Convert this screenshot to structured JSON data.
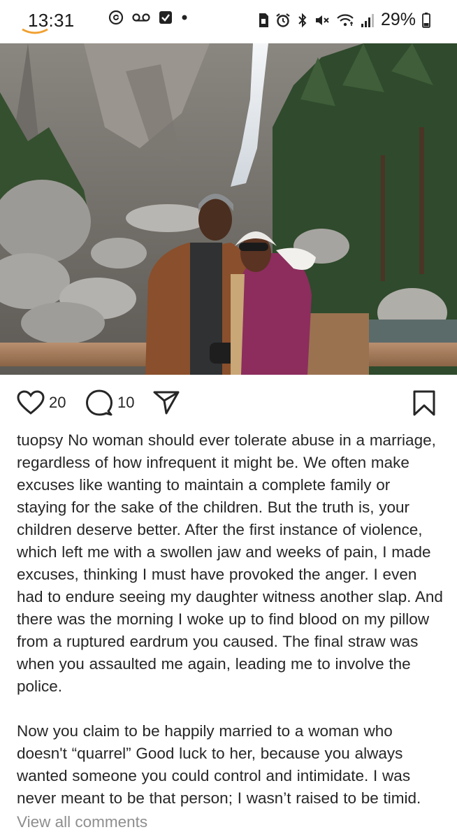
{
  "status_bar": {
    "time": "13:31",
    "battery_percent": "29%",
    "left_icons": [
      "threads-icon",
      "voicemail-icon",
      "checkbox-icon",
      "dot-icon"
    ],
    "right_icons": [
      "sim-icon",
      "alarm-icon",
      "bluetooth-icon",
      "mute-icon",
      "wifi-icon",
      "signal-icon",
      "battery-icon"
    ]
  },
  "post": {
    "image_alt": "",
    "likes_count": "20",
    "comments_count": "10",
    "username": "tuopsy",
    "caption_paragraph_1": "No woman should ever tolerate abuse in a marriage, regardless of how infrequent it might be. We often make excuses like wanting to maintain a complete family or staying for the sake of the children. But the truth is, your children deserve better. After the first instance of violence, which left me with a swollen jaw and weeks of pain, I made excuses, thinking I must have provoked the anger. I even had to endure seeing my daughter witness another slap. And there was the morning I woke up to find blood on my pillow from a ruptured eardrum you caused. The final straw was when you assaulted me again, leading me to involve the police.",
    "caption_paragraph_2": "Now you claim to be happily married to a woman who doesn't “quarrel” Good luck to her, because you always wanted someone you could control and intimidate. I was never meant to be that person; I wasn’t raised to be timid.",
    "view_all_comments": "View all comments"
  },
  "colors": {
    "text": "#262626",
    "muted": "#8e8e8e",
    "accent_orange": "#f0a030"
  }
}
